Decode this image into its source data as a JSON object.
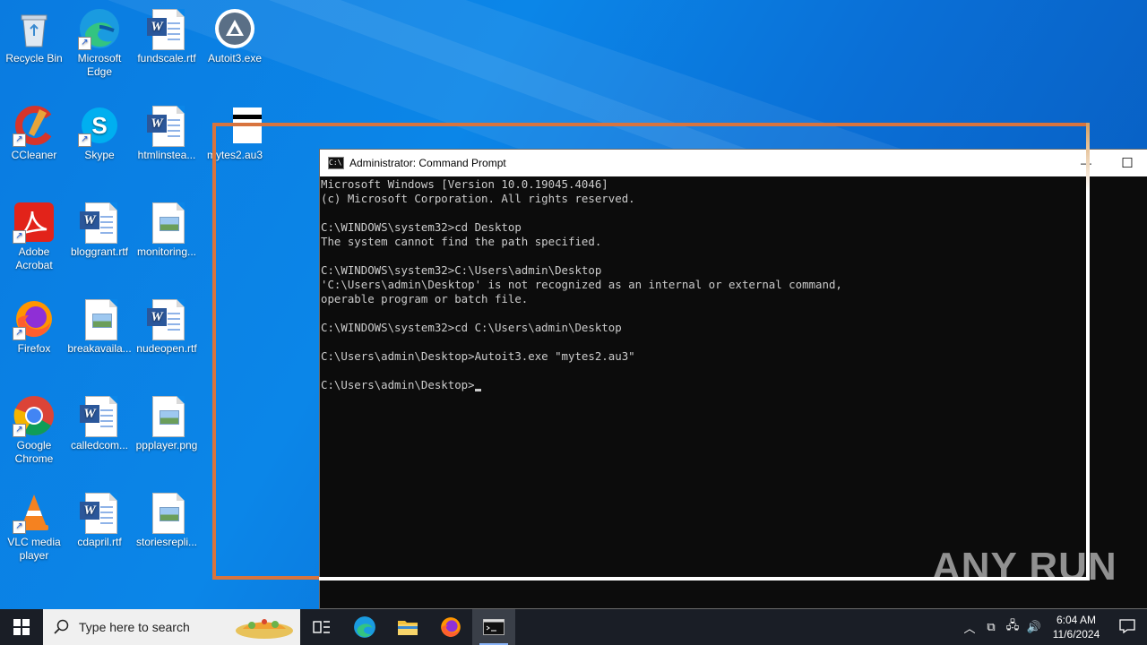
{
  "desktop": {
    "icons": [
      {
        "name": "recycle-bin",
        "label": "Recycle Bin"
      },
      {
        "name": "microsoft-edge",
        "label": "Microsoft Edge"
      },
      {
        "name": "fundscale",
        "label": "fundscale.rtf"
      },
      {
        "name": "autoit3",
        "label": "Autoit3.exe"
      },
      {
        "name": "ccleaner",
        "label": "CCleaner"
      },
      {
        "name": "skype",
        "label": "Skype"
      },
      {
        "name": "htmlinstea",
        "label": "htmlinstea..."
      },
      {
        "name": "mytes2",
        "label": "mytes2.au3"
      },
      {
        "name": "adobe-acrobat",
        "label": "Adobe Acrobat"
      },
      {
        "name": "bloggrant",
        "label": "bloggrant.rtf"
      },
      {
        "name": "monitoring",
        "label": "monitoring..."
      },
      {
        "name": "firefox",
        "label": "Firefox"
      },
      {
        "name": "breakavaila",
        "label": "breakavaila..."
      },
      {
        "name": "nudeopen",
        "label": "nudeopen.rtf"
      },
      {
        "name": "google-chrome",
        "label": "Google Chrome"
      },
      {
        "name": "calledcom",
        "label": "calledcom..."
      },
      {
        "name": "ppplayer",
        "label": "ppplayer.png"
      },
      {
        "name": "vlc",
        "label": "VLC media player"
      },
      {
        "name": "cdapril",
        "label": "cdapril.rtf"
      },
      {
        "name": "storiesrepli",
        "label": "storiesrepli..."
      }
    ]
  },
  "cmd": {
    "title": "Administrator: Command Prompt",
    "minimize": "—",
    "maximize": "☐",
    "lines": [
      "Microsoft Windows [Version 10.0.19045.4046]",
      "(c) Microsoft Corporation. All rights reserved.",
      "",
      "C:\\WINDOWS\\system32>cd Desktop",
      "The system cannot find the path specified.",
      "",
      "C:\\WINDOWS\\system32>C:\\Users\\admin\\Desktop",
      "'C:\\Users\\admin\\Desktop' is not recognized as an internal or external command,",
      "operable program or batch file.",
      "",
      "C:\\WINDOWS\\system32>cd C:\\Users\\admin\\Desktop",
      "",
      "C:\\Users\\admin\\Desktop>Autoit3.exe \"mytes2.au3\"",
      ""
    ],
    "prompt": "C:\\Users\\admin\\Desktop>"
  },
  "watermark": "ANY RUN",
  "taskbar": {
    "search_placeholder": "Type here to search",
    "apps": [
      "task-view",
      "edge",
      "file-explorer",
      "firefox",
      "command-prompt"
    ],
    "time": "6:04 AM",
    "date": "11/6/2024"
  }
}
